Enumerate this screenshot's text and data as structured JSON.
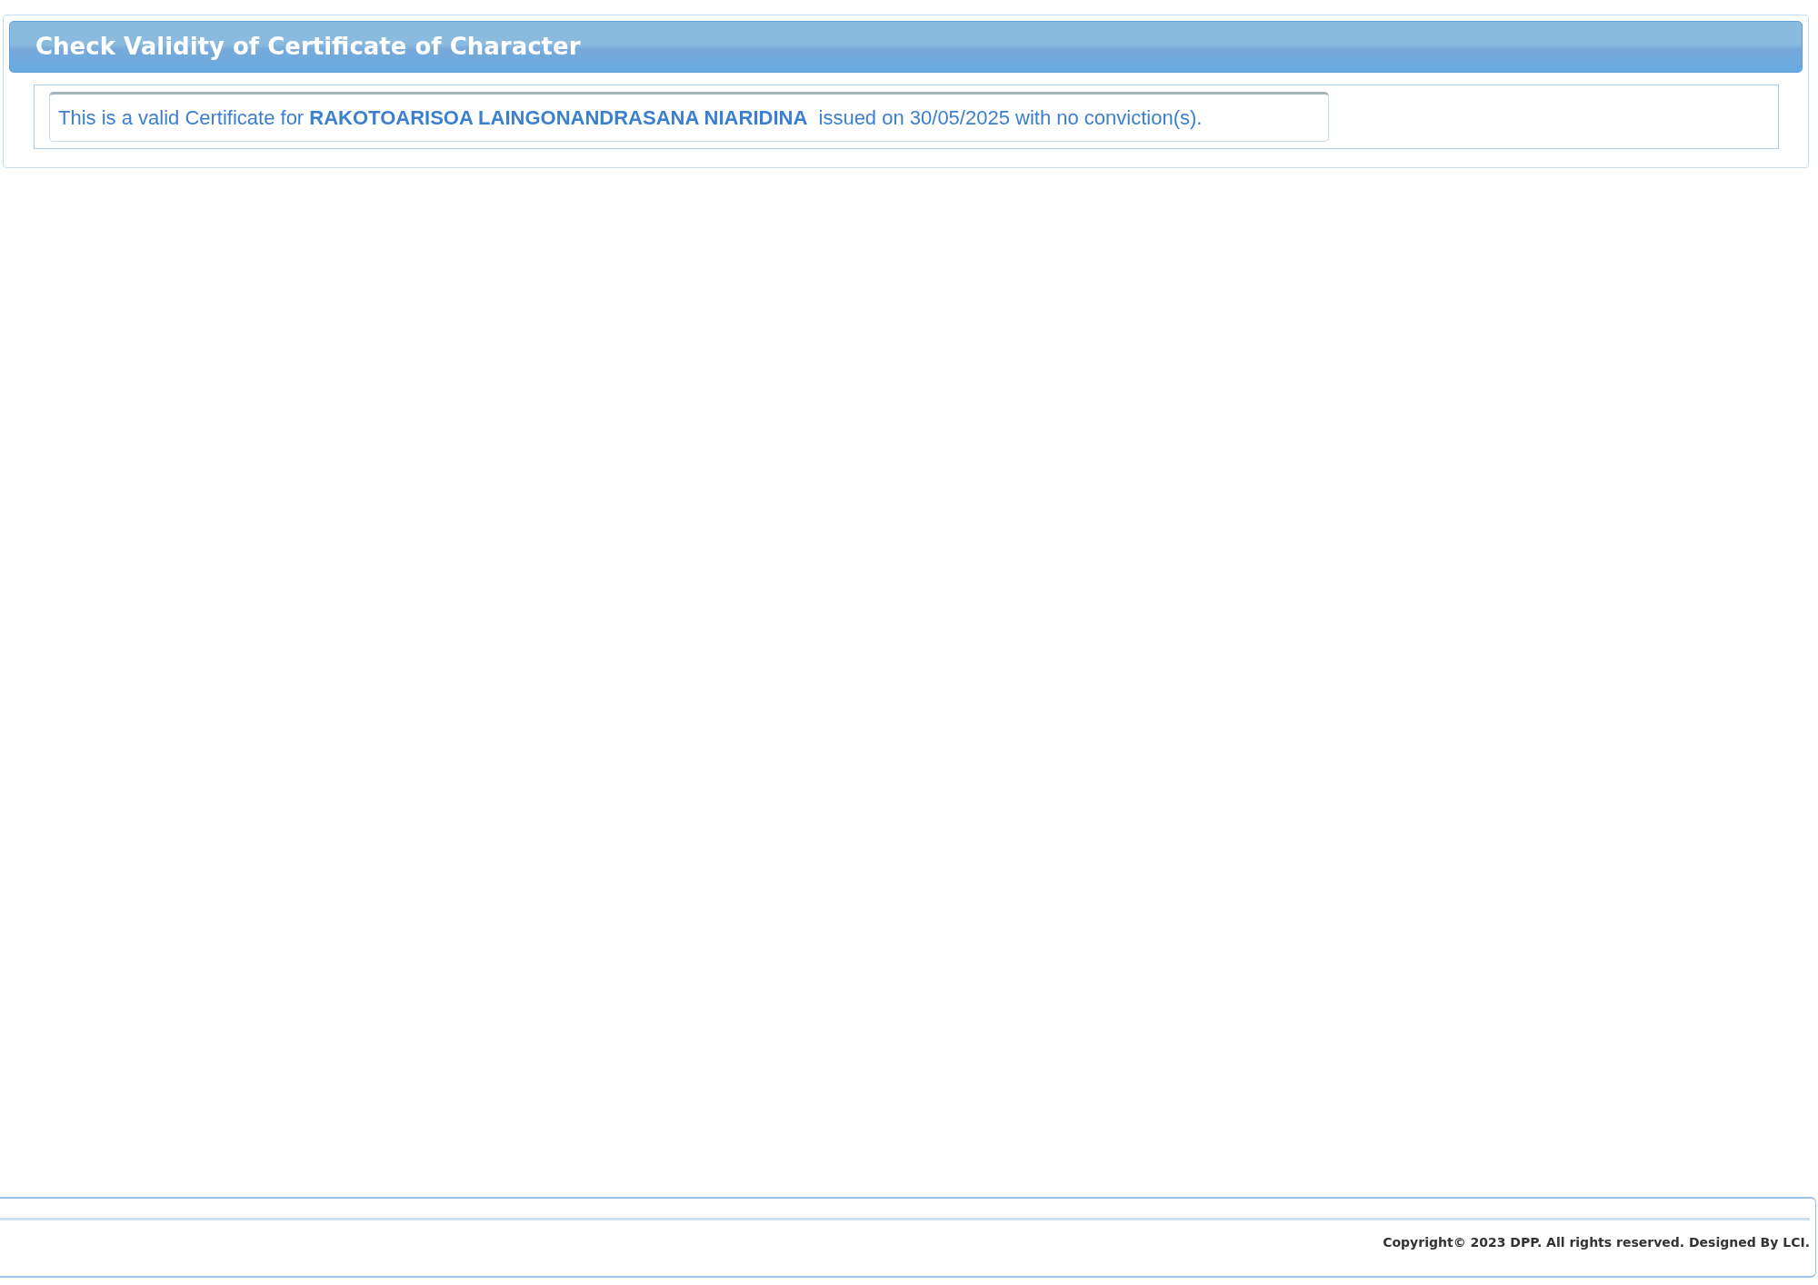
{
  "panel": {
    "title": "Check Validity of Certificate of Character",
    "message": "This is a valid Certificate for **RAKOTOARISOA LAINGONANDRASANA NIARIDINA**  issued on 30/05/2025 with no conviction(s)."
  },
  "footer": {
    "copyright": "Copyright© 2023 DPP. All rights reserved. Designed By LCI."
  }
}
